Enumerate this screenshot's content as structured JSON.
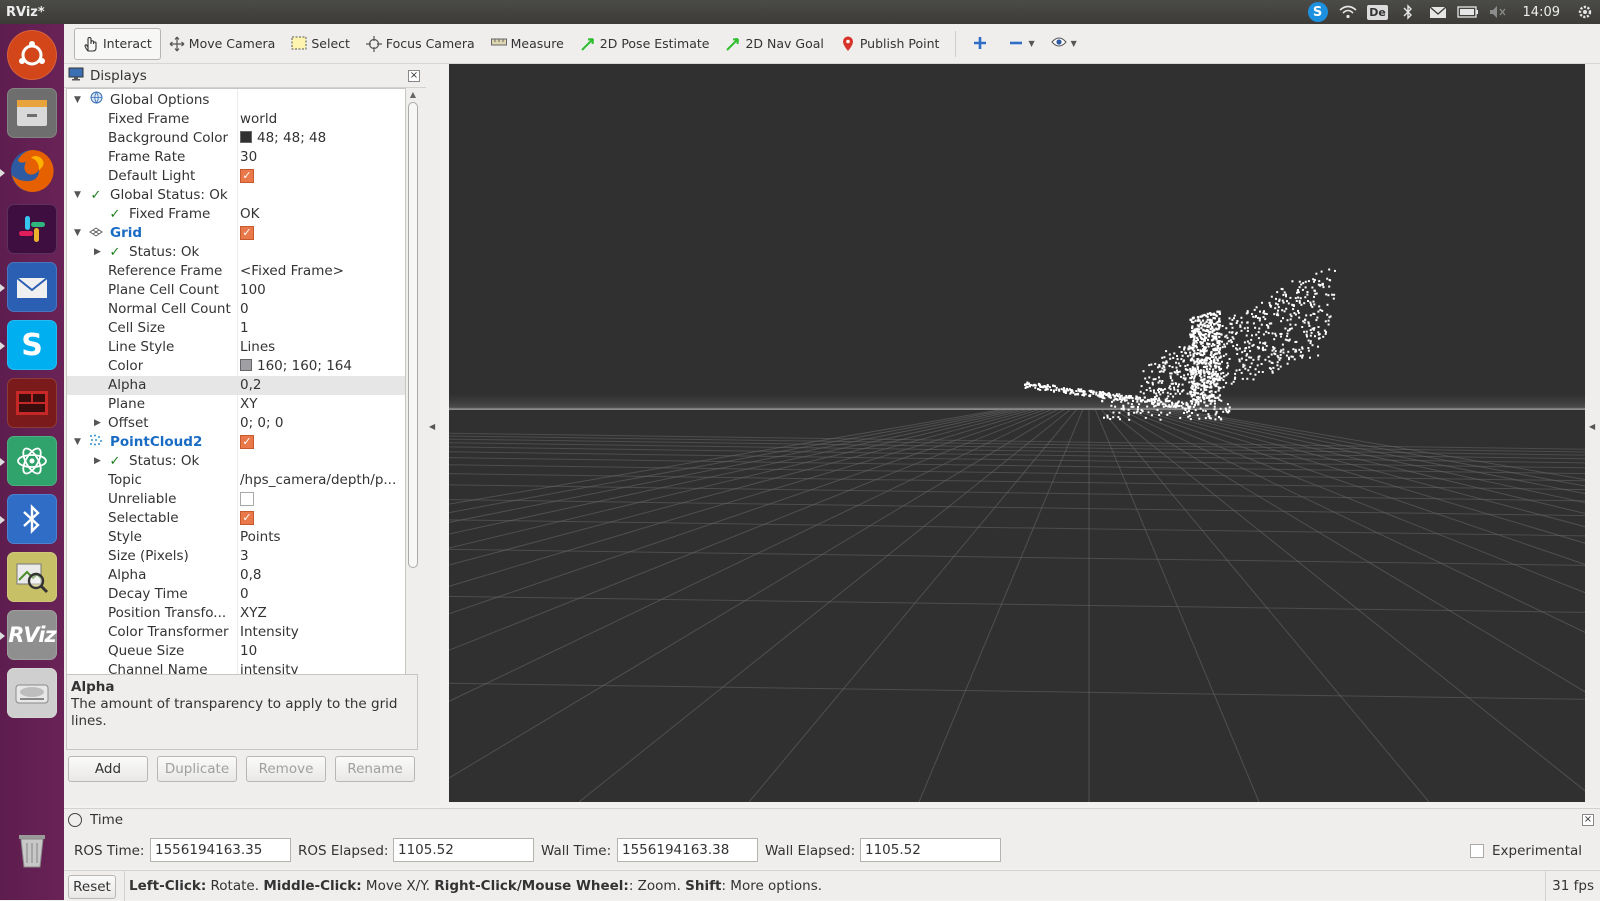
{
  "app_title": "RViz*",
  "top_panel": {
    "language": "De",
    "time": "14:09"
  },
  "toolbar": {
    "interact": "Interact",
    "move_camera": "Move Camera",
    "select": "Select",
    "focus_camera": "Focus Camera",
    "measure": "Measure",
    "pose_estimate": "2D Pose Estimate",
    "nav_goal": "2D Nav Goal",
    "publish_point": "Publish Point"
  },
  "launcher": {
    "items": [
      {
        "name": "ubuntu",
        "color": "#dd4814"
      },
      {
        "name": "files",
        "color": "#7a7a7a"
      },
      {
        "name": "firefox",
        "color": "#e66000"
      },
      {
        "name": "slack",
        "color": "#4a154b"
      },
      {
        "name": "thunderbird",
        "color": "#1f6fc4"
      },
      {
        "name": "skype",
        "color": "#00aff0"
      },
      {
        "name": "terminal-app",
        "color": "#b22222"
      },
      {
        "name": "atom",
        "color": "#3cb371"
      },
      {
        "name": "bluetooth",
        "color": "#3872c6"
      },
      {
        "name": "image-viewer",
        "color": "#9acd32"
      },
      {
        "name": "rviz",
        "color": "#8c8c8c"
      },
      {
        "name": "disk",
        "color": "#bdbdbd"
      },
      {
        "name": "trash",
        "color": "#9a9a9a"
      }
    ]
  },
  "displays": {
    "title": "Displays",
    "rows": [
      {
        "name": "Global Options",
        "value": ""
      },
      {
        "name": "Fixed Frame",
        "value": "world"
      },
      {
        "name": "Background Color",
        "value": "48; 48; 48"
      },
      {
        "name": "Frame Rate",
        "value": "30"
      },
      {
        "name": "Default Light",
        "value": ""
      },
      {
        "name": "Global Status: Ok",
        "value": ""
      },
      {
        "name": "Fixed Frame",
        "value": "OK"
      },
      {
        "name": "Grid",
        "value": ""
      },
      {
        "name": "Status: Ok",
        "value": ""
      },
      {
        "name": "Reference Frame",
        "value": "<Fixed Frame>"
      },
      {
        "name": "Plane Cell Count",
        "value": "100"
      },
      {
        "name": "Normal Cell Count",
        "value": "0"
      },
      {
        "name": "Cell Size",
        "value": "1"
      },
      {
        "name": "Line Style",
        "value": "Lines"
      },
      {
        "name": "Color",
        "value": "160; 160; 164"
      },
      {
        "name": "Alpha",
        "value": "0,2"
      },
      {
        "name": "Plane",
        "value": "XY"
      },
      {
        "name": "Offset",
        "value": "0; 0; 0"
      },
      {
        "name": "PointCloud2",
        "value": ""
      },
      {
        "name": "Status: Ok",
        "value": ""
      },
      {
        "name": "Topic",
        "value": "/hps_camera/depth/p..."
      },
      {
        "name": "Unreliable",
        "value": ""
      },
      {
        "name": "Selectable",
        "value": ""
      },
      {
        "name": "Style",
        "value": "Points"
      },
      {
        "name": "Size (Pixels)",
        "value": "3"
      },
      {
        "name": "Alpha",
        "value": "0,8"
      },
      {
        "name": "Decay Time",
        "value": "0"
      },
      {
        "name": "Position Transfo...",
        "value": "XYZ"
      },
      {
        "name": "Color Transformer",
        "value": "Intensity"
      },
      {
        "name": "Queue Size",
        "value": "10"
      },
      {
        "name": "Channel Name",
        "value": "intensity"
      }
    ],
    "colors": {
      "background": "#303030",
      "grid": "#a0a0a4"
    }
  },
  "help": {
    "title": "Alpha",
    "text": "The amount of transparency to apply to the grid lines."
  },
  "buttons": {
    "add": "Add",
    "duplicate": "Duplicate",
    "remove": "Remove",
    "rename": "Rename"
  },
  "time": {
    "title": "Time",
    "ros_time_label": "ROS Time:",
    "ros_time": "1556194163.35",
    "ros_elapsed_label": "ROS Elapsed:",
    "ros_elapsed": "1105.52",
    "wall_time_label": "Wall Time:",
    "wall_time": "1556194163.38",
    "wall_elapsed_label": "Wall Elapsed:",
    "wall_elapsed": "1105.52",
    "experimental": "Experimental"
  },
  "status": {
    "reset": "Reset",
    "left_click": "Left-Click:",
    "left_desc": " Rotate. ",
    "middle_click": "Middle-Click:",
    "middle_desc": " Move X/Y. ",
    "right_click": "Right-Click/Mouse Wheel:",
    "right_desc": ": Zoom. ",
    "shift": "Shift",
    "shift_desc": ": More options.",
    "fps": "31 fps"
  }
}
